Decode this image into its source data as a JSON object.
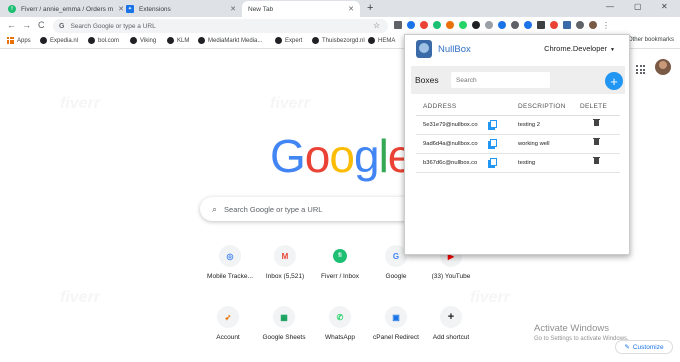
{
  "tabs": [
    {
      "title": "Fiverr / annie_emma / Orders m",
      "favicon_color": "#1dbf73"
    },
    {
      "title": "Extensions",
      "favicon_color": "#1a73e8"
    },
    {
      "title": "New Tab",
      "favicon_color": ""
    }
  ],
  "window_controls": {
    "minimize": "—",
    "maximize": "▢",
    "close": "✕",
    "new_tab": "+"
  },
  "toolbar": {
    "back": "←",
    "forward": "→",
    "reload": "C",
    "omnibox_placeholder": "Search Google or type a URL",
    "star": "☆"
  },
  "bookmarks": [
    {
      "label": "Apps",
      "color": "#e8710a"
    },
    {
      "label": "Expedia.nl",
      "color": "#202124"
    },
    {
      "label": "bol.com",
      "color": "#202124"
    },
    {
      "label": "Viking",
      "color": "#202124"
    },
    {
      "label": "KLM",
      "color": "#202124"
    },
    {
      "label": "MediaMarkt Media...",
      "color": "#202124"
    },
    {
      "label": "Expert",
      "color": "#202124"
    },
    {
      "label": "Thuisbezorgd.nl",
      "color": "#202124"
    },
    {
      "label": "HEMA",
      "color": "#202124"
    }
  ],
  "other_bookmarks": "Other bookmarks",
  "ntp": {
    "logo_letters": [
      {
        "ch": "G",
        "color": "#4285f4"
      },
      {
        "ch": "o",
        "color": "#ea4335"
      },
      {
        "ch": "o",
        "color": "#fbbc05"
      },
      {
        "ch": "g",
        "color": "#4285f4"
      },
      {
        "ch": "l",
        "color": "#34a853"
      },
      {
        "ch": "e",
        "color": "#ea4335"
      }
    ],
    "search_placeholder": "Search Google or type a URL",
    "shortcuts": [
      {
        "label": "Mobile Tracke...",
        "glyph": "◎",
        "color": "#4285f4"
      },
      {
        "label": "Inbox (5,521)",
        "glyph": "M",
        "color": "#ea4335"
      },
      {
        "label": "Fiverr / Inbox",
        "glyph": "fi",
        "color": "#1dbf73"
      },
      {
        "label": "Google",
        "glyph": "G",
        "color": "#4285f4"
      },
      {
        "label": "(33) YouTube",
        "glyph": "▶",
        "color": "#ff0000"
      },
      {
        "label": "Account",
        "glyph": "➶",
        "color": "#e8710a"
      },
      {
        "label": "Google Sheets",
        "glyph": "▦",
        "color": "#0f9d58"
      },
      {
        "label": "WhatsApp",
        "glyph": "✆",
        "color": "#25d366"
      },
      {
        "label": "cPanel Redirect",
        "glyph": "▣",
        "color": "#1a73e8"
      },
      {
        "label": "Add shortcut",
        "glyph": "+",
        "color": "#202124"
      }
    ],
    "activate_title": "Activate Windows",
    "activate_sub": "Go to Settings to activate Windows.",
    "customize": "Customize"
  },
  "nullbox": {
    "title": "NullBox",
    "account": "Chrome.Developer",
    "boxes_label": "Boxes",
    "search_placeholder": "Search",
    "add_label": "+",
    "columns": [
      "ADDRESS",
      "DESCRIPTION",
      "DELETE"
    ],
    "rows": [
      {
        "address": "5e31e79@nullbox.co",
        "description": "testing 2"
      },
      {
        "address": "9ad6d4a@nullbox.co",
        "description": "working well"
      },
      {
        "address": "b367d6c@nullbox.co",
        "description": "testing"
      }
    ]
  }
}
